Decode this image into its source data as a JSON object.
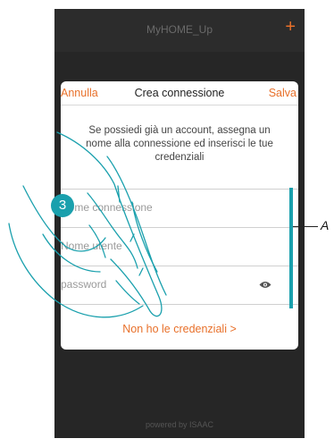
{
  "app": {
    "title": "MyHOME_Up",
    "add_icon": "plus-icon",
    "footer": "powered by ISAAC"
  },
  "dialog": {
    "cancel_label": "Annulla",
    "title": "Crea connessione",
    "save_label": "Salva",
    "intro": "Se possiedi già un account, assegna un nome alla connessione ed inserisci le tue credenziali",
    "fields": {
      "connection_name_placeholder": "Nome connessione",
      "email_placeholder": "Nome utente",
      "password_placeholder": "password"
    },
    "no_credentials_link": "Non ho le credenziali >"
  },
  "annotations": {
    "step_number": "3",
    "callout_letter": "A"
  },
  "colors": {
    "accent": "#e8702a",
    "annotation": "#1aa0ad",
    "background": "#262626"
  }
}
